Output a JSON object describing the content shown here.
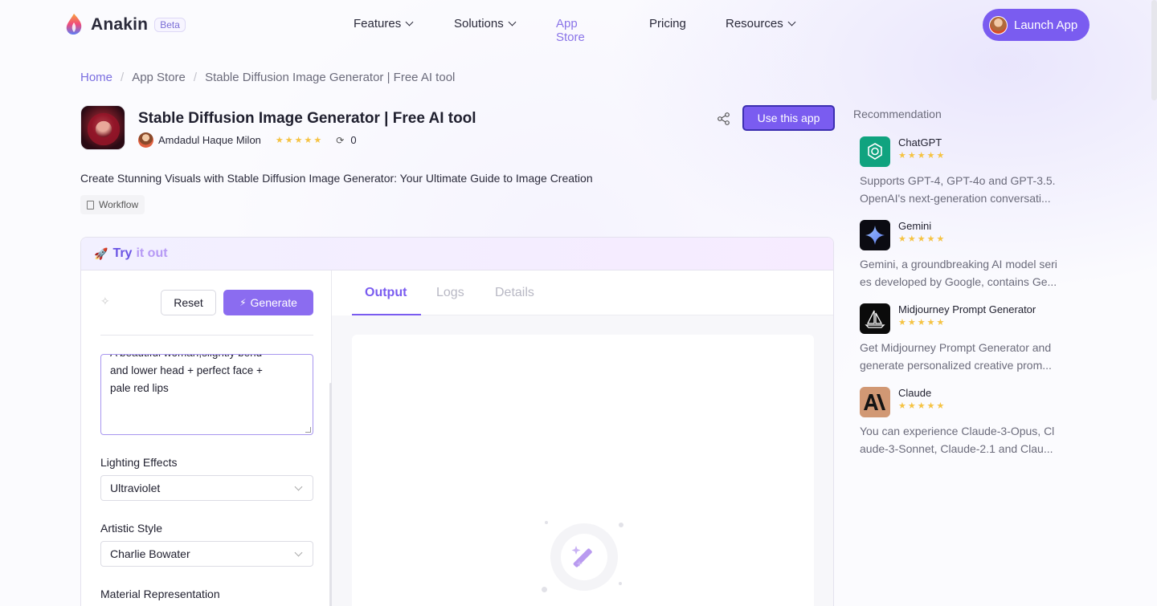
{
  "brand": {
    "name": "Anakin",
    "badge": "Beta"
  },
  "nav": [
    {
      "label": "Features",
      "dropdown": true,
      "active": false
    },
    {
      "label": "Solutions",
      "dropdown": true,
      "active": false
    },
    {
      "label": "App Store",
      "dropdown": false,
      "active": true
    },
    {
      "label": "Pricing",
      "dropdown": false,
      "active": false
    },
    {
      "label": "Resources",
      "dropdown": true,
      "active": false
    }
  ],
  "launch_button": "Launch App",
  "breadcrumb": {
    "home": "Home",
    "section": "App Store",
    "current": "Stable Diffusion Image Generator | Free AI tool"
  },
  "app": {
    "title": "Stable Diffusion Image Generator | Free AI tool",
    "author": "Amdadul Haque Milon",
    "rating": 5,
    "runs": "0",
    "use_button": "Use this app",
    "description": "Create Stunning Visuals with Stable Diffusion Image Generator: Your Ultimate Guide to Image Creation",
    "tag": "Workflow"
  },
  "try_it": {
    "title_part1": "Try",
    "title_part2": "it out",
    "reset": "Reset",
    "generate": "Generate",
    "prompt_partial_line": "A beautiful woman,slightly bend",
    "prompt_lines": [
      "and lower head + perfect face +",
      "pale red lips"
    ],
    "fields": {
      "lighting_label": "Lighting Effects",
      "lighting_value": "Ultraviolet",
      "style_label": "Artistic Style",
      "style_value": "Charlie Bowater",
      "material_label": "Material Representation"
    },
    "tabs": [
      "Output",
      "Logs",
      "Details"
    ],
    "active_tab": "Output"
  },
  "recommendations": {
    "title": "Recommendation",
    "items": [
      {
        "name": "ChatGPT",
        "desc_line1": "Supports GPT-4, GPT-4o and GPT-3.5.",
        "desc_line2": "OpenAI's next-generation conversati...",
        "icon": "chatgpt-icon",
        "color": "#10a37f"
      },
      {
        "name": "Gemini",
        "desc_line1": "Gemini, a groundbreaking AI model seri",
        "desc_line2": "es developed by Google, contains Ge...",
        "icon": "gemini-icon",
        "color": "#0b0b12"
      },
      {
        "name": "Midjourney Prompt Generator",
        "desc_line1": "Get Midjourney Prompt Generator and",
        "desc_line2": "generate personalized creative prom...",
        "icon": "midjourney-icon",
        "color": "#0b0b0b"
      },
      {
        "name": "Claude",
        "desc_line1": "You can experience Claude-3-Opus, Cl",
        "desc_line2": "aude-3-Sonnet, Claude-2.1 and Clau...",
        "icon": "claude-icon",
        "color": "#d19874"
      }
    ]
  },
  "colors": {
    "accent": "#7a5cf0",
    "star": "#f5c343",
    "link": "#7a6ee0"
  }
}
